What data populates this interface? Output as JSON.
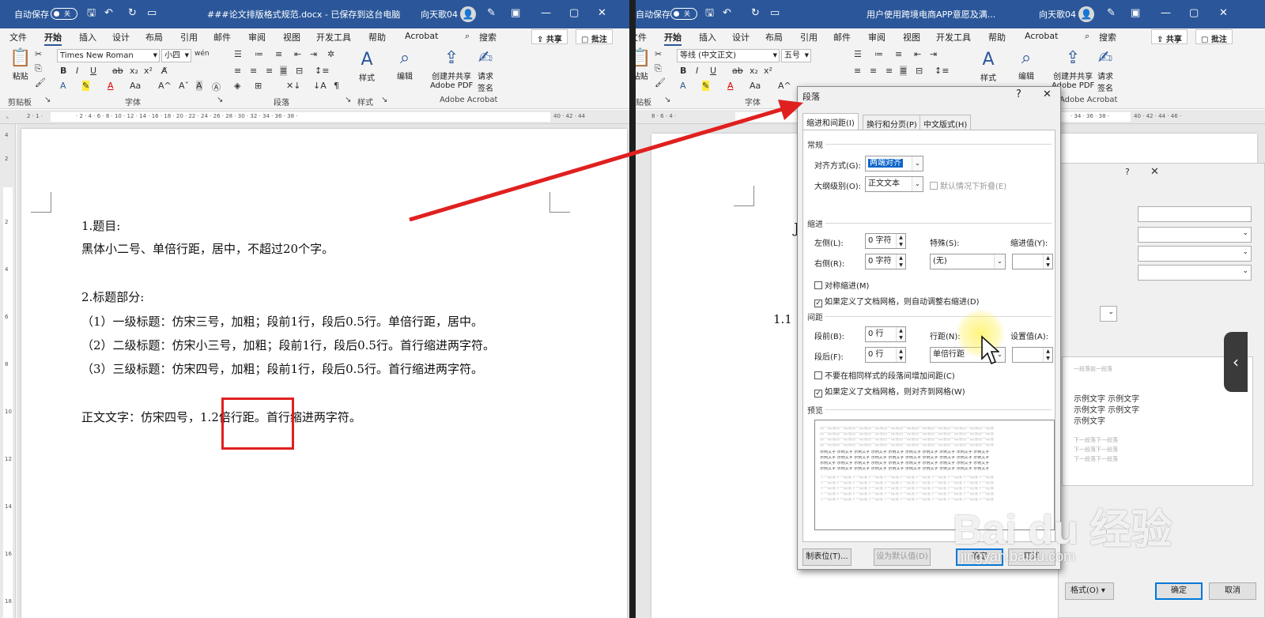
{
  "left": {
    "autosave_label": "自动保存",
    "autosave_state": "关",
    "title": "###论文排版格式规范.docx - 已保存到这台电脑",
    "user": "向天歌04",
    "tabs": [
      "文件",
      "开始",
      "插入",
      "设计",
      "布局",
      "引用",
      "邮件",
      "审阅",
      "视图",
      "开发工具",
      "帮助",
      "Acrobat"
    ],
    "search": "搜索",
    "share": "共享",
    "comments": "批注",
    "font_name": "Times New Roman",
    "font_size": "小四",
    "group_clipboard": "剪贴板",
    "group_font": "字体",
    "group_paragraph": "段落",
    "group_styles": "样式",
    "group_acrobat": "Adobe Acrobat",
    "paste": "粘贴",
    "styles": "样式",
    "edit": "编辑",
    "create_pdf": "创建并共享\nAdobe PDF",
    "sign": "请求\n签名",
    "doc_lines": [
      "1.题目:",
      "黑体小二号、单倍行距，居中，不超过20个字。",
      "2.标题部分:",
      "（1）一级标题：仿宋三号，加粗；段前1行，段后0.5行。单倍行距，居中。",
      "（2）二级标题：仿宋小三号，加粗；段前1行，段后0.5行。首行缩进两字符。",
      "（3）三级标题：仿宋四号，加粗；段前1行，段后0.5行。首行缩进两字符。",
      "正文文字：仿宋四号，1.2倍行距。首行缩进两字符。"
    ]
  },
  "right": {
    "autosave_label": "自动保存",
    "autosave_state": "关",
    "title": "用户使用跨境电商APP意愿及满...",
    "user": "向天歌04",
    "tabs": [
      "文件",
      "开始",
      "插入",
      "设计",
      "布局",
      "引用",
      "邮件",
      "审阅",
      "视图",
      "开发工具",
      "帮助",
      "Acrobat"
    ],
    "search": "搜索",
    "share": "共享",
    "comments": "批注",
    "font_name": "等线 (中文正文)",
    "font_size": "五号",
    "group_clipboard": "剪贴板",
    "group_font": "字体",
    "group_acrobat": "Adobe Acrobat",
    "paste": "粘贴",
    "styles": "样式",
    "edit": "编辑",
    "create_pdf": "创建并共享\nAdobe PDF",
    "sign": "请求\n签名",
    "doc_fragment": "1.1",
    "doc_fragment2": "J",
    "panel_lines": [
      "一段落前一段落",
      "示例文字  示例文字",
      "示例文字  示例文字",
      "示例文字",
      "下一段落下一段落",
      "下一段落下一段落",
      "下一段落下一段落"
    ],
    "panel_ok": "确定",
    "panel_cancel": "取消",
    "panel_format": "格式(O)"
  },
  "dialog": {
    "title": "段落",
    "help": "?",
    "close": "✕",
    "tabs": [
      "缩进和间距(I)",
      "换行和分页(P)",
      "中文版式(H)"
    ],
    "general": "常规",
    "alignment_label": "对齐方式(G):",
    "alignment_value": "两端对齐",
    "outline_label": "大纲级别(O):",
    "outline_value": "正文文本",
    "collapse_label": "默认情况下折叠(E)",
    "indent": "缩进",
    "left_label": "左侧(L):",
    "left_value": "0 字符",
    "right_label": "右侧(R):",
    "right_value": "0 字符",
    "special_label": "特殊(S):",
    "special_value": "(无)",
    "indent_by_label": "缩进值(Y):",
    "mirror_label": "对称缩进(M)",
    "auto_indent_label": "如果定义了文档网格，则自动调整右缩进(D)",
    "spacing": "间距",
    "before_label": "段前(B):",
    "before_value": "0 行",
    "after_label": "段后(F):",
    "after_value": "0 行",
    "line_spacing_label": "行距(N):",
    "line_spacing_value": "单倍行距",
    "at_label": "设置值(A):",
    "no_space_label": "不要在相同样式的段落间增加间距(C)",
    "snap_grid_label": "如果定义了文档网格，则对齐到网格(W)",
    "preview": "预览",
    "preview_prev": "前一段落前一段落前一段落前一段落前一段落前一段落前一段落前一段落前一段落前一段落前一段落",
    "preview_sample": "示例文字 示例文字 示例文字 示例文字 示例文字 示例文字 示例文字 示例文字 示例文字 示例文字",
    "preview_next": "下一段落下一段落下一段落下一段落下一段落下一段落下一段落下一段落下一段落下一段落下一段落",
    "tabs_button": "制表位(T)...",
    "default_button": "设为默认值(D)",
    "ok_button": "确定",
    "cancel_button": "取消"
  },
  "watermark": {
    "logo": "Bai du 经验",
    "url": "jingyan.baidu.com"
  },
  "colors": {
    "title_bar": "#2b579a",
    "annotation_red": "#e02020",
    "selection": "#0a64c8"
  }
}
